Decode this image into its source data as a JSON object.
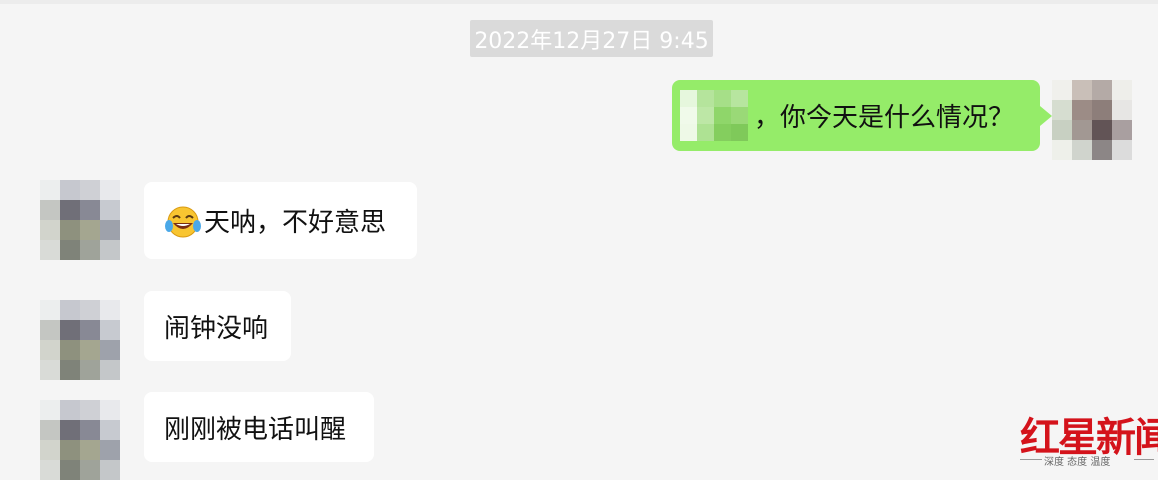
{
  "chat": {
    "timestamp": "2022年12月27日 9:45",
    "messages": [
      {
        "direction": "out",
        "text": "，你今天是什么情况？"
      },
      {
        "direction": "in",
        "text": "天呐，不好意思",
        "emoji": "laughing-with-tears-emoji"
      },
      {
        "direction": "in",
        "text": "闹钟没响"
      },
      {
        "direction": "in",
        "text": "刚刚被电话叫醒"
      }
    ]
  },
  "watermark": {
    "title": "红星新闻",
    "slogan": "深度 态度 温度"
  },
  "colors": {
    "background": "#f5f5f5",
    "outgoing_bubble": "#95ec69",
    "incoming_bubble": "#ffffff",
    "timestamp_bg": "#dadada",
    "watermark_red": "#d4131b"
  }
}
